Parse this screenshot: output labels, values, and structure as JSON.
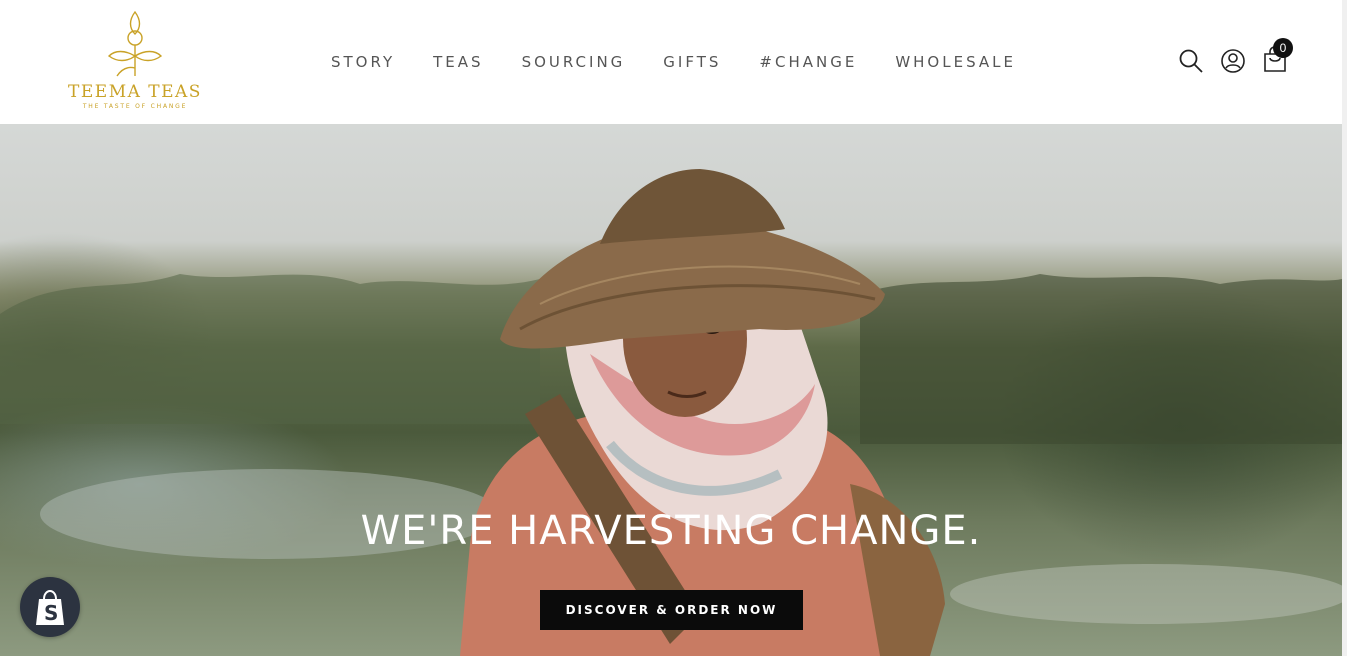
{
  "brand": {
    "name": "TEEMA TEAS",
    "tagline": "THE TASTE OF CHANGE",
    "color": "#c9a227"
  },
  "nav": {
    "items": [
      {
        "label": "STORY"
      },
      {
        "label": "TEAS"
      },
      {
        "label": "SOURCING"
      },
      {
        "label": "GIFTS"
      },
      {
        "label": "#CHANGE"
      },
      {
        "label": "WHOLESALE"
      }
    ]
  },
  "header_icons": {
    "search": "search-icon",
    "account": "account-icon",
    "cart": "cart-icon",
    "cart_count": "0"
  },
  "hero": {
    "headline": "WE'RE HARVESTING CHANGE.",
    "cta_label": "DISCOVER & ORDER NOW",
    "image": "woman-in-conical-hat-tea-field"
  },
  "floating": {
    "shopify_badge": "shopify-bag-icon"
  }
}
